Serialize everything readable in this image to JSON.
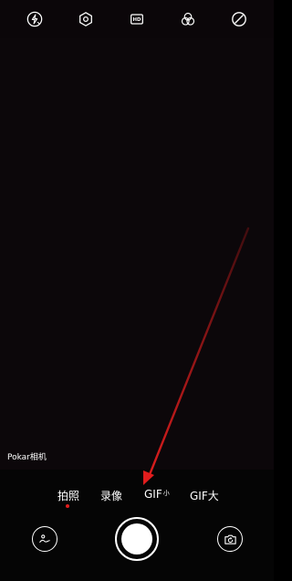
{
  "toolbar": {
    "icons": [
      "flash-off-icon",
      "settings-icon",
      "hd-icon",
      "filter-icon",
      "no-effect-icon"
    ],
    "hd_label": "HD"
  },
  "viewfinder": {
    "watermark": "Pokar相机"
  },
  "modes": {
    "items": [
      {
        "label": "拍照",
        "active": true
      },
      {
        "label": "录像",
        "active": false
      },
      {
        "label": "GIF",
        "suffix": "小",
        "active": false
      },
      {
        "label": "GIF大",
        "active": false
      }
    ]
  },
  "controls": {
    "icons": [
      "gallery-icon",
      "shutter-button",
      "switch-camera-icon"
    ]
  },
  "colors": {
    "background": "#0c070a",
    "accent": "#e11d1d",
    "foreground": "#ffffff"
  }
}
